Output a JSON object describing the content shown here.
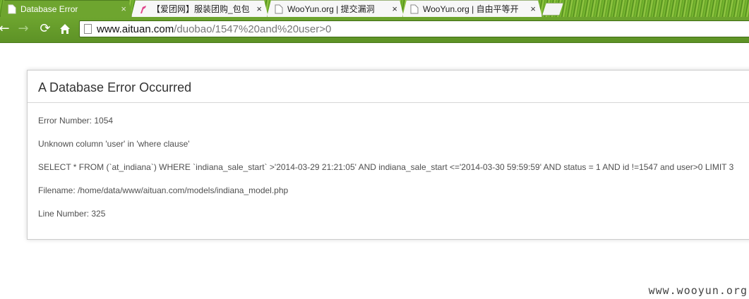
{
  "browser": {
    "tabs": [
      {
        "title": "Database Error",
        "active": true,
        "favicon": "page-icon"
      },
      {
        "title": "【爱团网】服装团购_包包",
        "active": false,
        "favicon": "high-heel-icon"
      },
      {
        "title": "WooYun.org | 提交漏洞",
        "active": false,
        "favicon": "page-icon"
      },
      {
        "title": "WooYun.org | 自由平等开",
        "active": false,
        "favicon": "page-icon"
      }
    ],
    "close_glyph": "×",
    "url_host": "www.aituan.com",
    "url_path": "/duobao/1547%20and%20user>0",
    "theme_color": "#6ea52f"
  },
  "error": {
    "heading": "A Database Error Occurred",
    "number_line": "Error Number: 1054",
    "message": "Unknown column 'user' in 'where clause'",
    "sql": "SELECT * FROM (`at_indiana`) WHERE `indiana_sale_start` >'2014-03-29 21:21:05' AND indiana_sale_start <='2014-03-30 59:59:59' AND status = 1 AND id !=1547 and user>0 LIMIT 3",
    "filename": "Filename: /home/data/www/aituan.com/models/indiana_model.php",
    "line": "Line Number: 325"
  },
  "watermark": "www.wooyun.org"
}
